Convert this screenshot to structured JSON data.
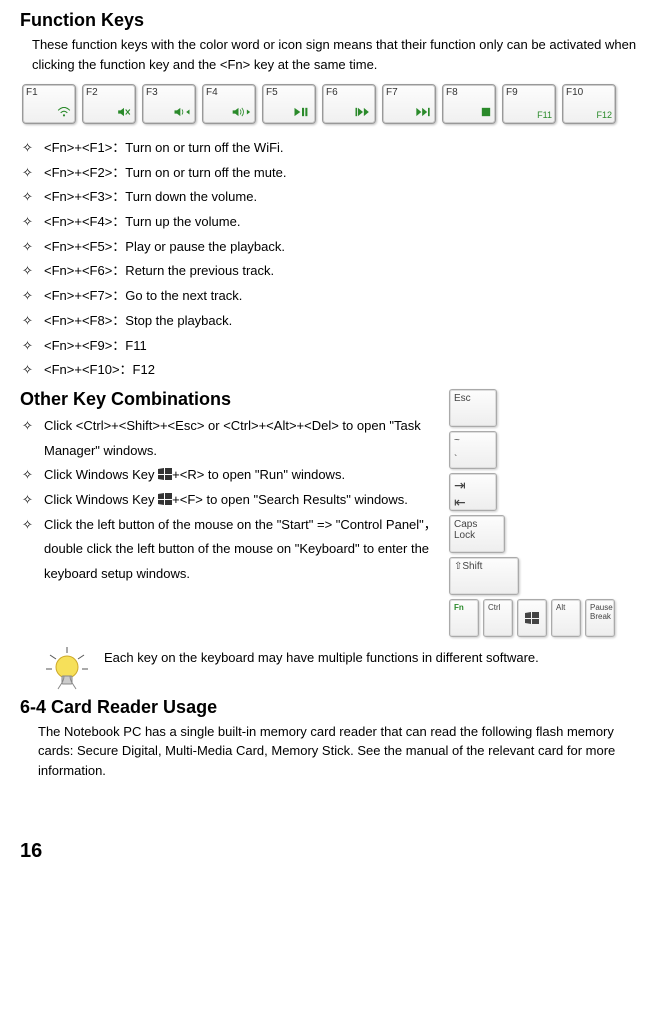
{
  "section1": {
    "title": "Function Keys",
    "intro": "These function keys with the color word or icon sign means that their function only can be activated when clicking the function key and the <Fn> key at the same time."
  },
  "fkeys": [
    {
      "label": "F1",
      "icon": "wifi"
    },
    {
      "label": "F2",
      "icon": "mute"
    },
    {
      "label": "F3",
      "icon": "voldown"
    },
    {
      "label": "F4",
      "icon": "volup"
    },
    {
      "label": "F5",
      "icon": "playpause"
    },
    {
      "label": "F6",
      "icon": "prev"
    },
    {
      "label": "F7",
      "icon": "next"
    },
    {
      "label": "F8",
      "icon": "stop"
    },
    {
      "label": "F9",
      "sub": "F11"
    },
    {
      "label": "F10",
      "sub": "F12"
    }
  ],
  "fn_list": [
    "<Fn>+<F1>：Turn on or turn off the WiFi.",
    "<Fn>+<F2>：Turn on or turn off the mute.",
    "<Fn>+<F3>：Turn down the volume.",
    "<Fn>+<F4>：Turn up the volume.",
    "<Fn>+<F5>：Play or pause the playback.",
    "<Fn>+<F6>：Return the previous track.",
    "<Fn>+<F7>：Go to the next track.",
    "<Fn>+<F8>：Stop the playback.",
    "<Fn>+<F9>：F11",
    "<Fn>+<F10>：F12"
  ],
  "section2": {
    "title": "Other Key Combinations"
  },
  "other_list": {
    "i0": "Click <Ctrl>+<Shift>+<Esc> or <Ctrl>+<Alt>+<Del> to open \"Task Manager\" windows.",
    "i1a": "Click Windows Key ",
    "i1b": "+<R> to open \"Run\" windows.",
    "i2a": "Click Windows Key ",
    "i2b": "+<F> to open \"Search Results\" windows.",
    "i3": "Click the left button of the mouse on the \"Start\" => \"Control Panel\"，double click the left button of the mouse on \"Keyboard\" to enter the keyboard setup windows."
  },
  "side_keys": {
    "esc": "Esc",
    "tilde_top": "~",
    "tilde_bot": "`",
    "tab": "⇥",
    "caps": "Caps Lock",
    "shift": "⇧Shift",
    "fn": "Fn",
    "ctrl": "Ctrl",
    "win": "win",
    "alt": "Alt",
    "pause": "Pause Break"
  },
  "note": "Each key on the keyboard may have multiple functions in different software.",
  "section3": {
    "title": "6-4 Card Reader Usage",
    "body": "The Notebook PC has a single built-in memory card reader that can read the following flash memory cards: Secure Digital, Multi-Media Card, Memory Stick. See the manual of the relevant card for more information."
  },
  "page_number": "16"
}
